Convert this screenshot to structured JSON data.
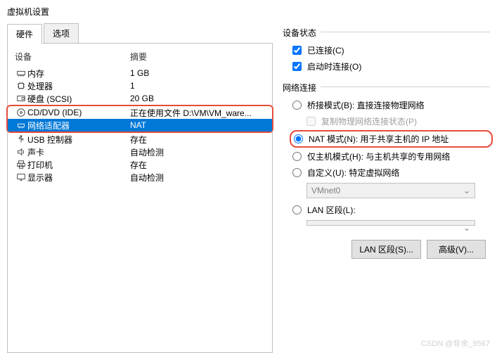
{
  "window": {
    "title": "虚拟机设置"
  },
  "tabs": {
    "hardware": "硬件",
    "options": "选项"
  },
  "list": {
    "header_device": "设备",
    "header_summary": "摘要",
    "rows": [
      {
        "icon": "memory",
        "device": "内存",
        "summary": "1 GB"
      },
      {
        "icon": "cpu",
        "device": "处理器",
        "summary": "1"
      },
      {
        "icon": "disk",
        "device": "硬盘 (SCSI)",
        "summary": "20 GB"
      },
      {
        "icon": "cd",
        "device": "CD/DVD (IDE)",
        "summary": "正在使用文件 D:\\VM\\VM_ware..."
      },
      {
        "icon": "network",
        "device": "网络适配器",
        "summary": "NAT"
      },
      {
        "icon": "usb",
        "device": "USB 控制器",
        "summary": "存在"
      },
      {
        "icon": "sound",
        "device": "声卡",
        "summary": "自动检测"
      },
      {
        "icon": "printer",
        "device": "打印机",
        "summary": "存在"
      },
      {
        "icon": "display",
        "device": "显示器",
        "summary": "自动检测"
      }
    ]
  },
  "status": {
    "section_title": "设备状态",
    "connected": "已连接(C)",
    "connect_at_boot": "启动时连接(O)"
  },
  "network": {
    "section_title": "网络连接",
    "bridged": "桥接模式(B): 直接连接物理网络",
    "replicate": "复制物理网络连接状态(P)",
    "nat": "NAT 模式(N): 用于共享主机的 IP 地址",
    "host_only": "仅主机模式(H): 与主机共享的专用网络",
    "custom": "自定义(U): 特定虚拟网络",
    "vmnet": "VMnet0",
    "lan_segment": "LAN 区段(L):"
  },
  "buttons": {
    "lan_segments": "LAN 区段(S)...",
    "advanced": "高级(V)..."
  },
  "watermark": "CSDN @非余_9567"
}
